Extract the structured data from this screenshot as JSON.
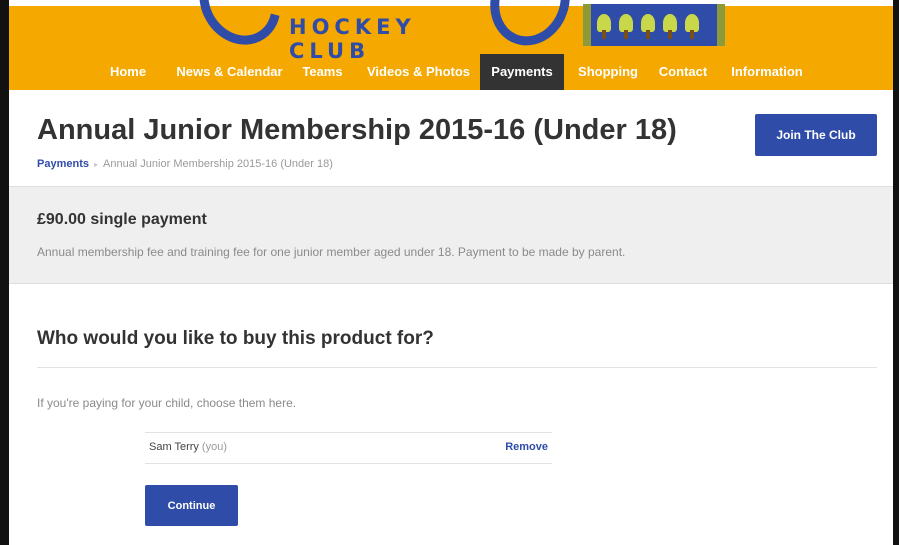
{
  "header": {
    "logo_text": "HOCKEY CLUB",
    "brand_color": "#f5a800",
    "accent_color": "#2f4ca8"
  },
  "nav": {
    "items": [
      {
        "label": "Home"
      },
      {
        "label": "News & Calendar"
      },
      {
        "label": "Teams"
      },
      {
        "label": "Videos & Photos"
      },
      {
        "label": "Payments",
        "active": true
      },
      {
        "label": "Shopping"
      },
      {
        "label": "Contact"
      },
      {
        "label": "Information"
      }
    ]
  },
  "page": {
    "title": "Annual Junior Membership 2015-16 (Under 18)",
    "join_label": "Join The Club",
    "breadcrumb": {
      "parent": "Payments",
      "separator": "▸",
      "current": "Annual Junior Membership 2015-16 (Under 18)"
    }
  },
  "product": {
    "price_title": "£90.00 single payment",
    "description": "Annual membership fee and training fee for one junior member aged under 18. Payment to be made by parent."
  },
  "purchase": {
    "question": "Who would you like to buy this product for?",
    "hint": "If you're paying for your child, choose them here.",
    "person": {
      "name": "Sam Terry",
      "tag": "(you)",
      "remove_label": "Remove"
    },
    "continue_label": "Continue"
  }
}
